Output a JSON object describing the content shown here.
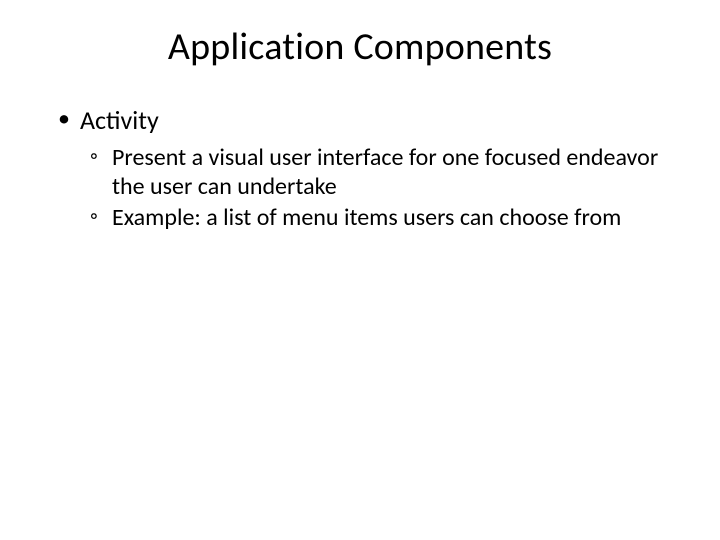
{
  "title": "Application Components",
  "bullets": {
    "l1_0": "Activity",
    "l2_0": "Present a visual user interface for one focused endeavor the user can undertake",
    "l2_1": "Example: a list of menu items users can choose from"
  }
}
